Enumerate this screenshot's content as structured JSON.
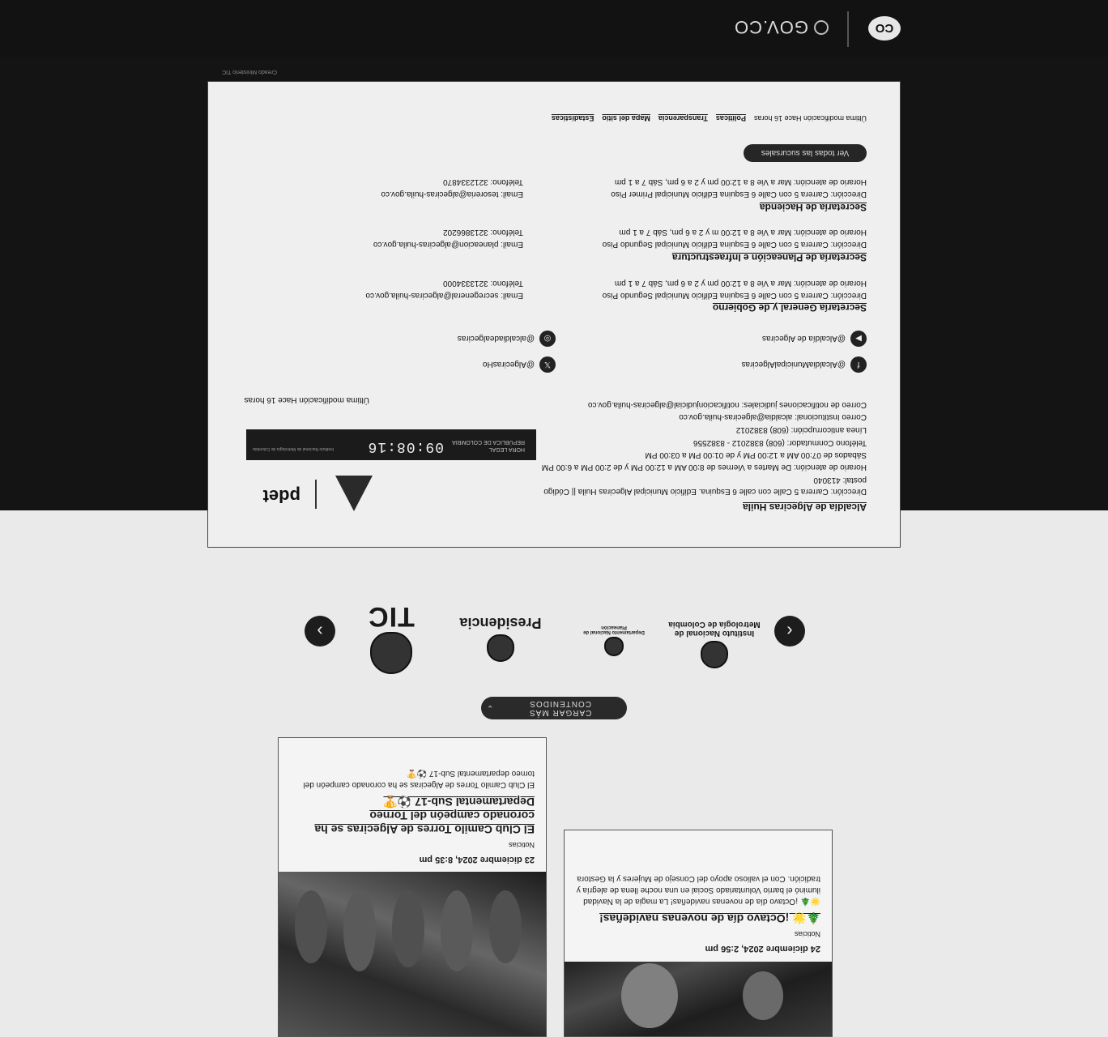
{
  "header": {
    "co_logo": "CO",
    "brand": "GOV.CO",
    "brand_icon": "escudo-icon"
  },
  "news": [
    {
      "date": "24 diciembre 2024, 2:56 pm",
      "category": "Noticias",
      "title": "🎄🌟 ¡Octavo día de novenas navideñas!",
      "excerpt": "🌟🎄 ¡Octavo día de novenas navideñas! La magia de la Navidad iluminó el barrio Voluntariado Social en una noche llena de alegría y tradición. Con el valioso apoyo del Consejo de Mujeres y la Gestora"
    },
    {
      "date": "23 diciembre 2024, 8:35 pm",
      "category": "Noticias",
      "title": "El Club Camilo Torres de Algeciras se ha coronado campeón del Torneo Departamental Sub-17 ⚽🏆",
      "excerpt": "El Club Camilo Torres de Algeciras se ha coronado campeón del torneo departamental Sub-17 ⚽🏆"
    }
  ],
  "load_more": "CARGAR MÁS CONTENIDOS",
  "carousel": {
    "prev_icon": "chevron-left-icon",
    "next_icon": "chevron-right-icon",
    "logos": [
      {
        "name": "Instituto Nacional de Metrología de Colombia"
      },
      {
        "name": "Departamento Nacional de Planeación"
      },
      {
        "name": "Presidencia"
      },
      {
        "name": "TIC"
      }
    ]
  },
  "footer": {
    "alcaldia": {
      "title": "Alcaldía de Algeciras Huila",
      "direccion": "Dirección: Carrera 5 Calle con calle 6 Esquina. Edificio Municipal Algeciras Huila || Código",
      "postal": "postal: 413040",
      "horario": "Horario de atención: De Martes a Viernes de 8:00 AM a 12:00 PM y de 2:00 PM a 6:00 PM",
      "sabados": "Sábados de 07:00 AM a 12:00 PM y de 01:00 PM a 03:00 PM",
      "telefono": "Teléfono Conmutador: (608) 8382012 - 8382556",
      "anticorrupcion": "Línea anticorrupción: (608) 8382012",
      "correo": "Correo Institucional: alcaldia@algeciras-huila.gov.co",
      "notificaciones": "Correo de notificaciones judiciales: notificacionjudicial@algeciras-huila.gov.co"
    },
    "last_mod_1": "Última modificación Hace 16 horas",
    "hora_legal": {
      "time": "09:08:16",
      "label1": "HORA LEGAL",
      "label2": "REPÚBLICA DE COLOMBIA",
      "inst": "Instituto Nacional de Metrología de Colombia"
    },
    "social": [
      {
        "icon": "facebook-icon",
        "handle": "@AlcaldiaMunicipalAlgeciras"
      },
      {
        "icon": "twitter-icon",
        "handle": "@AlgecirasHo"
      },
      {
        "icon": "youtube-icon",
        "handle": "@Alcaldía de Algeciras"
      },
      {
        "icon": "instagram-icon",
        "handle": "@alcaldiadealgeciras"
      }
    ],
    "sections": [
      {
        "title": "Secretaría General y de Gobierno",
        "direccion": "Dirección: Carrera 5 con Calle 6 Esquina Edificio Municipal Segundo Piso",
        "email": "Email: secregeneral@algeciras-huila.gov.co",
        "horario": "Horario de atención: Mar a Vie 8 a 12:00 pm y 2 a 6 pm, Sáb 7 a 1 pm",
        "telefono": "Teléfono: 3213334000"
      },
      {
        "title": "Secretaría de Planeación e Infraestructura",
        "direccion": "Dirección: Carrera 5 con Calle 6 Esquina Edificio Municipal Segundo Piso",
        "email": "Email: planeacion@algeciras-huila.gov.co",
        "horario": "Horario de atención: Mar a Vie 8 a 12:00 m y 2 a 6 pm, Sáb 7 a 1 pm",
        "telefono": "Teléfono: 3213866202"
      },
      {
        "title": "Secretaría de Hacienda",
        "direccion": "Dirección: Carrera 5 con Calle 6 Esquina Edificio Municipal Primer Piso",
        "email": "Email: tesoreria@algeciras-huila.gov.co",
        "horario": "Horario de atención: Mar a Vie 8 a 12:00 pm y 2 a 6 pm, Sáb 7 a 1 pm",
        "telefono": "Teléfono: 3212334870"
      }
    ],
    "branches_button": "Ver todas las sucursales",
    "last_mod_2": "Última modificación Hace 16 horas",
    "links": [
      "Políticas",
      "Transparencia",
      "Mapa del sitio",
      "Estadísticas"
    ],
    "credit": "Creado Ministerio TIC"
  }
}
